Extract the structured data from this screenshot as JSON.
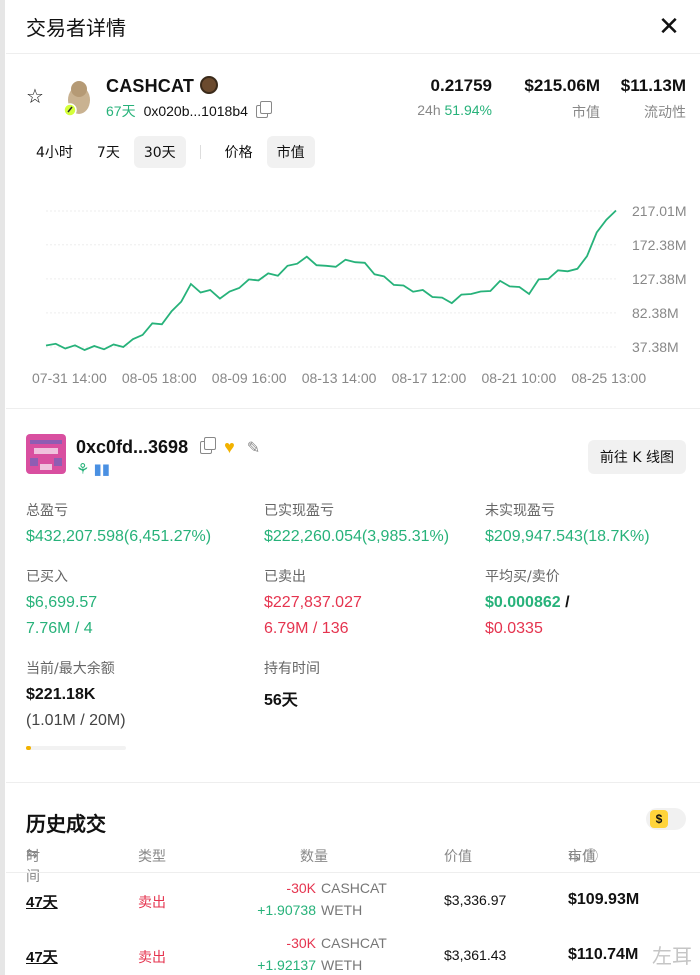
{
  "header": {
    "title": "交易者详情",
    "close": "✕"
  },
  "token": {
    "name": "CASHCAT",
    "age": "67天",
    "address": "0x020b...1018b4",
    "price": "0.21759",
    "change_label": "24h",
    "change": "51.94%",
    "market_cap": "$215.06M",
    "market_cap_label": "市值",
    "liquidity": "$11.13M",
    "liquidity_label": "流动性"
  },
  "tabs": {
    "time": [
      "4小时",
      "7天",
      "30天"
    ],
    "active_time": "30天",
    "mode": [
      "价格",
      "市值"
    ],
    "active_mode": "市值"
  },
  "chart_data": {
    "type": "line",
    "y_ticks": [
      "217.01M",
      "172.38M",
      "127.38M",
      "82.38M",
      "37.38M"
    ],
    "y_tick_values": [
      217.01,
      172.38,
      127.38,
      82.38,
      37.38
    ],
    "x_ticks": [
      "07-31 14:00",
      "08-05 18:00",
      "08-09 16:00",
      "08-13 14:00",
      "08-17 12:00",
      "08-21 10:00",
      "08-25 13:00"
    ],
    "ylim": [
      37.38,
      217.01
    ],
    "series_color": "#27b27a",
    "values": [
      42,
      39,
      38,
      37,
      36,
      36,
      37,
      38,
      40,
      45,
      56,
      66,
      70,
      82,
      100,
      118,
      112,
      110,
      104,
      108,
      118,
      124,
      128,
      132,
      134,
      142,
      150,
      154,
      148,
      142,
      146,
      150,
      152,
      146,
      136,
      128,
      122,
      116,
      113,
      110,
      106,
      100,
      98,
      104,
      110,
      108,
      114,
      122,
      120,
      114,
      110,
      124,
      130,
      136,
      140,
      138,
      160,
      186,
      208,
      215
    ]
  },
  "trader": {
    "address": "0xc0fd...3698",
    "kline_button": "前往 K 线图",
    "total_pnl_label": "总盈亏",
    "total_pnl": "$432,207.598(6,451.27%)",
    "realized_label": "已实现盈亏",
    "realized": "$222,260.054(3,985.31%)",
    "unrealized_label": "未实现盈亏",
    "unrealized": "$209,947.543(18.7K%)",
    "bought_label": "已买入",
    "bought": "$6,699.57",
    "bought_qty": "7.76M / 4",
    "sold_label": "已卖出",
    "sold": "$227,837.027",
    "sold_qty": "6.79M / 136",
    "avg_label": "平均买/卖价",
    "avg_buy": "$0.000862",
    "avg_slash": "/",
    "avg_sell": "$0.0335",
    "balance_label": "当前/最大余额",
    "balance": "$221.18K",
    "balance_range": "(1.01M / 20M)",
    "balance_progress": 0.05,
    "hold_label": "持有时间",
    "hold": "56天"
  },
  "history": {
    "title": "历史成交",
    "col_time": "时间",
    "col_type": "类型",
    "col_qty": "数量",
    "col_value": "价值",
    "col_mcap": "市值",
    "rows": [
      {
        "time": "47天",
        "type": "卖出",
        "qty1": "-30K",
        "sym1": "CASHCAT",
        "qty2": "+1.90738",
        "sym2": "WETH",
        "value": "$3,336.97",
        "mcap": "$109.93M"
      },
      {
        "time": "47天",
        "type": "卖出",
        "qty1": "-30K",
        "sym1": "CASHCAT",
        "qty2": "+1.92137",
        "sym2": "WETH",
        "value": "$3,361.43",
        "mcap": "$110.74M"
      }
    ]
  },
  "watermark": "左耳"
}
